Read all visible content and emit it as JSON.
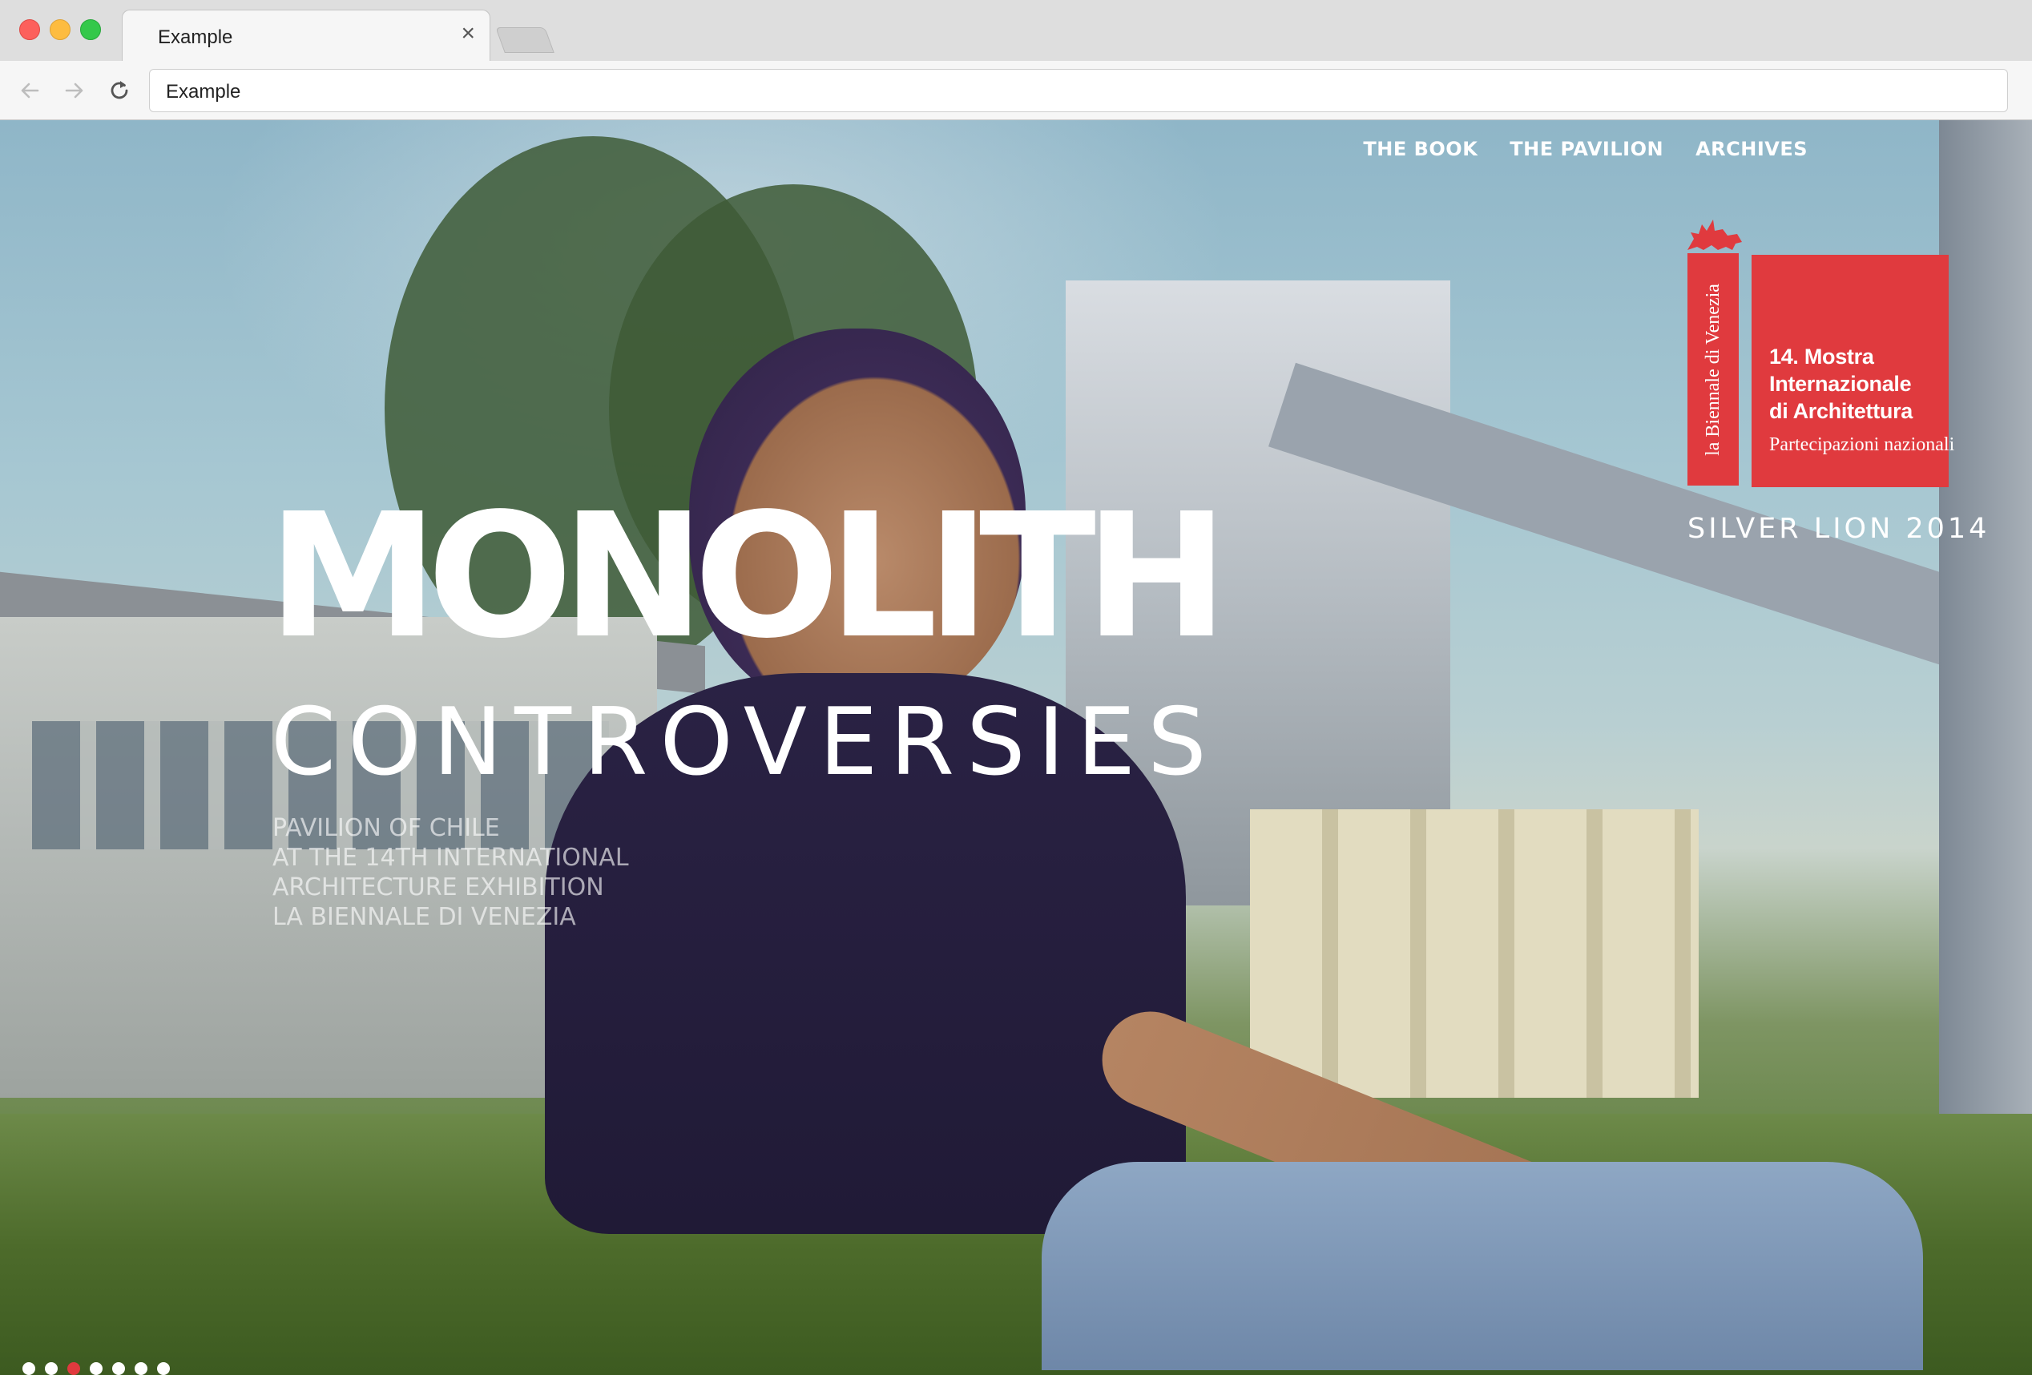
{
  "browser": {
    "tab_title": "Example",
    "tab_close": "×",
    "url": "Example"
  },
  "nav": {
    "items": [
      {
        "label": "THE BOOK"
      },
      {
        "label": "THE PAVILION"
      },
      {
        "label": "ARCHIVES"
      }
    ]
  },
  "badge": {
    "vertical_text": "la Biennale di Venezia",
    "lines": [
      "14. Mostra",
      "Internazionale",
      "di Architettura"
    ],
    "sub": "Partecipazioni nazionali",
    "award": "SILVER LION 2014",
    "color": "#e03a3e"
  },
  "hero": {
    "title": "MONOLITH",
    "subtitle": "CONTROVERSIES",
    "description": [
      "PAVILION OF CHILE",
      "AT THE 14TH INTERNATIONAL",
      "ARCHITECTURE EXHIBITION",
      "LA BIENNALE DI VENEZIA"
    ]
  },
  "slider": {
    "count": 7,
    "active_index": 2
  },
  "icons": {
    "back": "arrow-left-icon",
    "forward": "arrow-right-icon",
    "reload": "reload-icon",
    "close": "close-icon",
    "lion": "winged-lion-icon"
  }
}
